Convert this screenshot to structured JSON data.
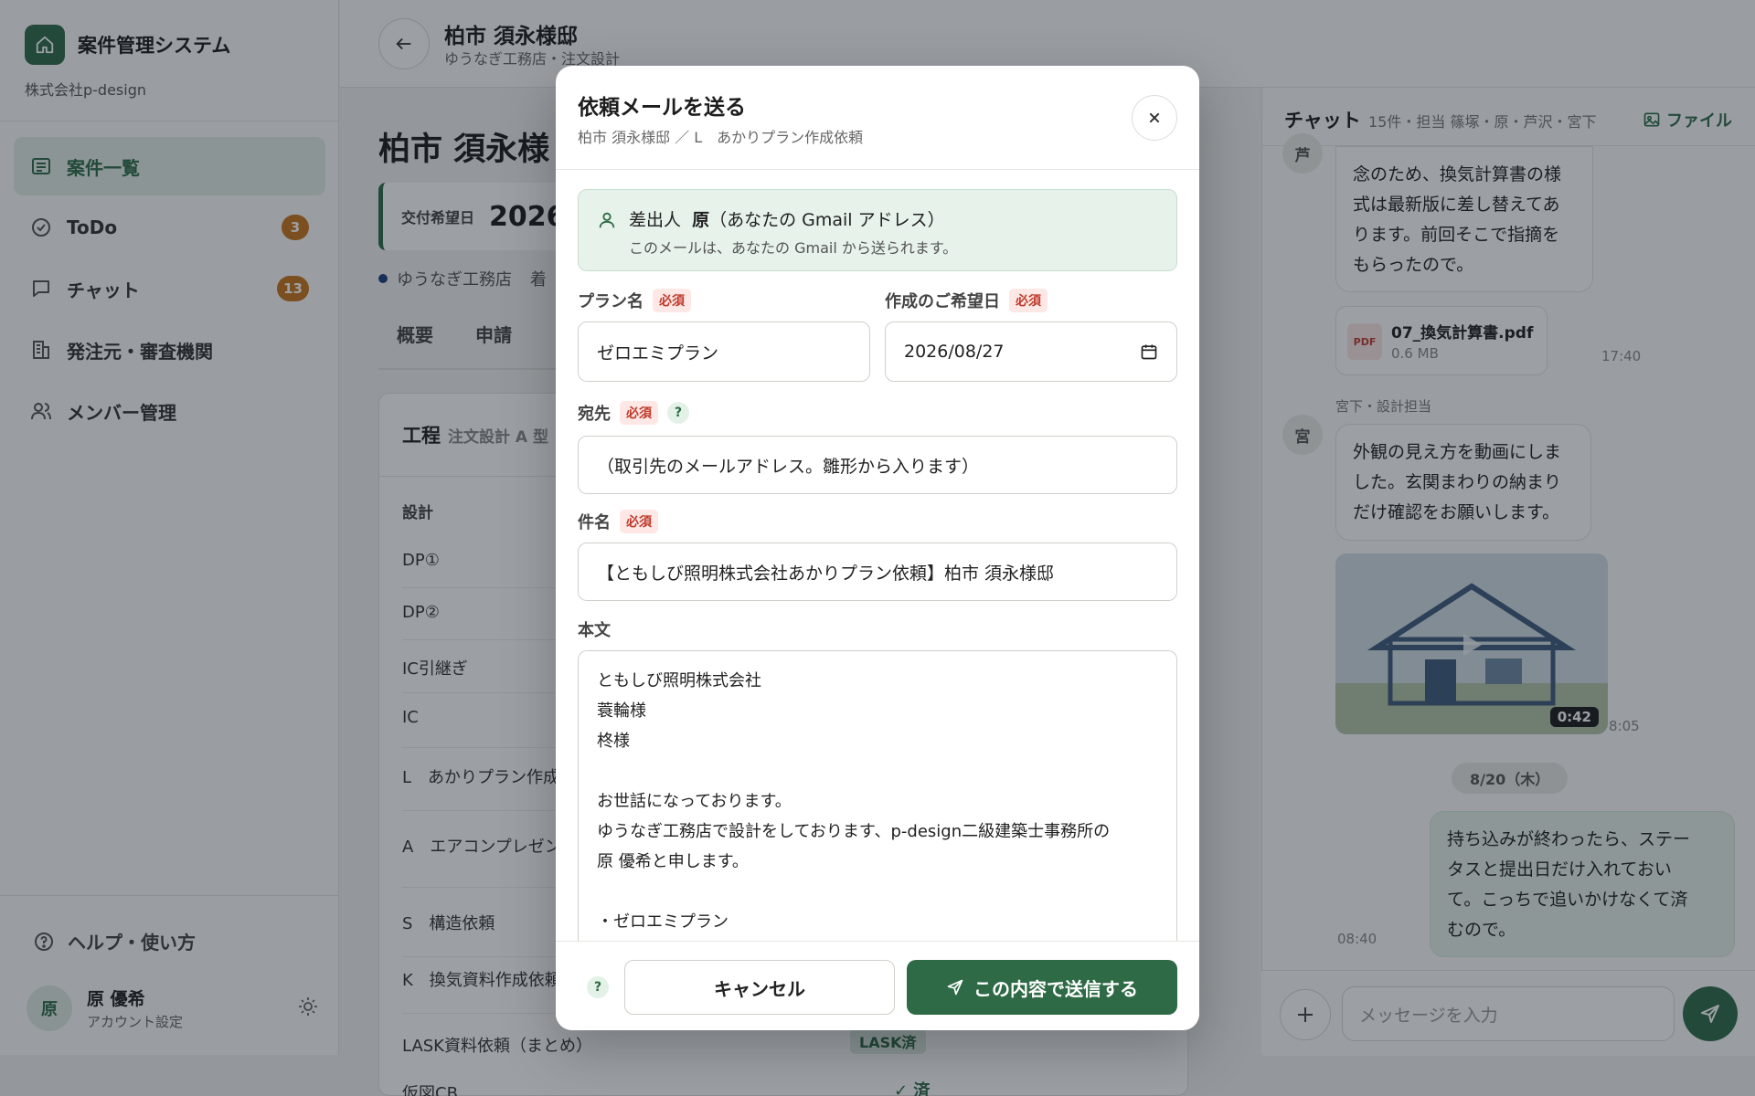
{
  "app": {
    "title": "案件管理システム",
    "company": "株式会社p-design"
  },
  "sidebar": {
    "items": [
      {
        "label": "案件一覧",
        "icon": "list-icon",
        "active": true
      },
      {
        "label": "ToDo",
        "icon": "check-circle-icon",
        "badge": "3"
      },
      {
        "label": "チャット",
        "icon": "chat-icon",
        "badge": "13"
      },
      {
        "label": "発注元・審査機関",
        "icon": "building-icon"
      },
      {
        "label": "メンバー管理",
        "icon": "users-icon"
      }
    ],
    "help": "ヘルプ・使い方",
    "user": {
      "initial": "原",
      "name": "原 優希",
      "sub": "アカウント設定"
    }
  },
  "header": {
    "title": "柏市 須永様邸",
    "subtitle": "ゆうなぎ工務店・注文設計"
  },
  "main": {
    "title": "柏市 須永様",
    "date_label": "交付希望日",
    "date_value": "2026",
    "builder": "ゆうなぎ工務店",
    "builder_suffix": "着",
    "tabs": [
      "概要",
      "申請"
    ],
    "panel_title": "工程",
    "panel_sub": "注文設計 A 型",
    "steps_header": "設計",
    "steps": [
      "DP①",
      "DP②",
      "IC引継ぎ",
      "IC",
      "L　あかりプラン作成",
      "A　エアコンプレゼン",
      "S　構造依頼",
      "K　換気資料作成依頼",
      "LASK資料依頼（まとめ）",
      "仮図CB"
    ],
    "lask_badge": "LASK済",
    "done_mark": "✓ 済"
  },
  "chat": {
    "title": "チャット",
    "meta": "15件・担当 篠塚・原・芦沢・宮下",
    "file_link": "ファイル",
    "messages": [
      {
        "avatar": "芦",
        "text": [
          "念のため、換気計算書の様",
          "式は最新版に差し替えてあ",
          "ります。前回そこで指摘を",
          "もらったので。"
        ]
      },
      {
        "file_name": "07_換気計算書.pdf",
        "file_size": "0.6 MB",
        "file_type": "PDF",
        "time": "17:40"
      },
      {
        "sender": "宮下・設計担当",
        "avatar": "宮",
        "text": [
          "外観の見え方を動画にしま",
          "した。玄関まわりの納まり",
          "だけ確認をお願いします。"
        ]
      },
      {
        "video_duration": "0:42",
        "time": "8:05"
      },
      {
        "date_chip": "8/20（木）"
      },
      {
        "mine": true,
        "time": "08:40",
        "text": [
          "持ち込みが終わったら、ステー",
          "タスと提出日だけ入れておい",
          "て。こっちで追いかけなくて済",
          "むので。"
        ]
      }
    ],
    "input_placeholder": "メッセージを入力"
  },
  "modal": {
    "title": "依頼メールを送る",
    "subtitle": "柏市 須永様邸 ／ L　あかりプラン作成依頼",
    "sender_prefix": "差出人",
    "sender_name": "原",
    "sender_suffix": "（あなたの Gmail アドレス）",
    "sender_note": "このメールは、あなたの Gmail から送られます。",
    "required": "必須",
    "plan_label": "プラン名",
    "plan_value": "ゼロエミプラン",
    "date_label": "作成のご希望日",
    "date_value": "2026/08/27",
    "to_label": "宛先",
    "to_value": "（取引先のメールアドレス。雛形から入ります）",
    "subject_label": "件名",
    "subject_value": "【ともしび照明株式会社あかりプラン依頼】柏市 須永様邸",
    "body_label": "本文",
    "body_lines": [
      "ともしび照明株式会社",
      "蓑輪様",
      "柊様",
      "",
      "お世話になっております。",
      "ゆうなぎ工務店で設計をしております、p-design二級建築士事務所の",
      "原 優希と申します。",
      "",
      "・ゼロエミプラン"
    ],
    "cancel": "キャンセル",
    "send": "この内容で送信する"
  },
  "colors": {
    "brand": "#2d6a45",
    "badge": "#c9741a",
    "required": "#c0392b"
  }
}
